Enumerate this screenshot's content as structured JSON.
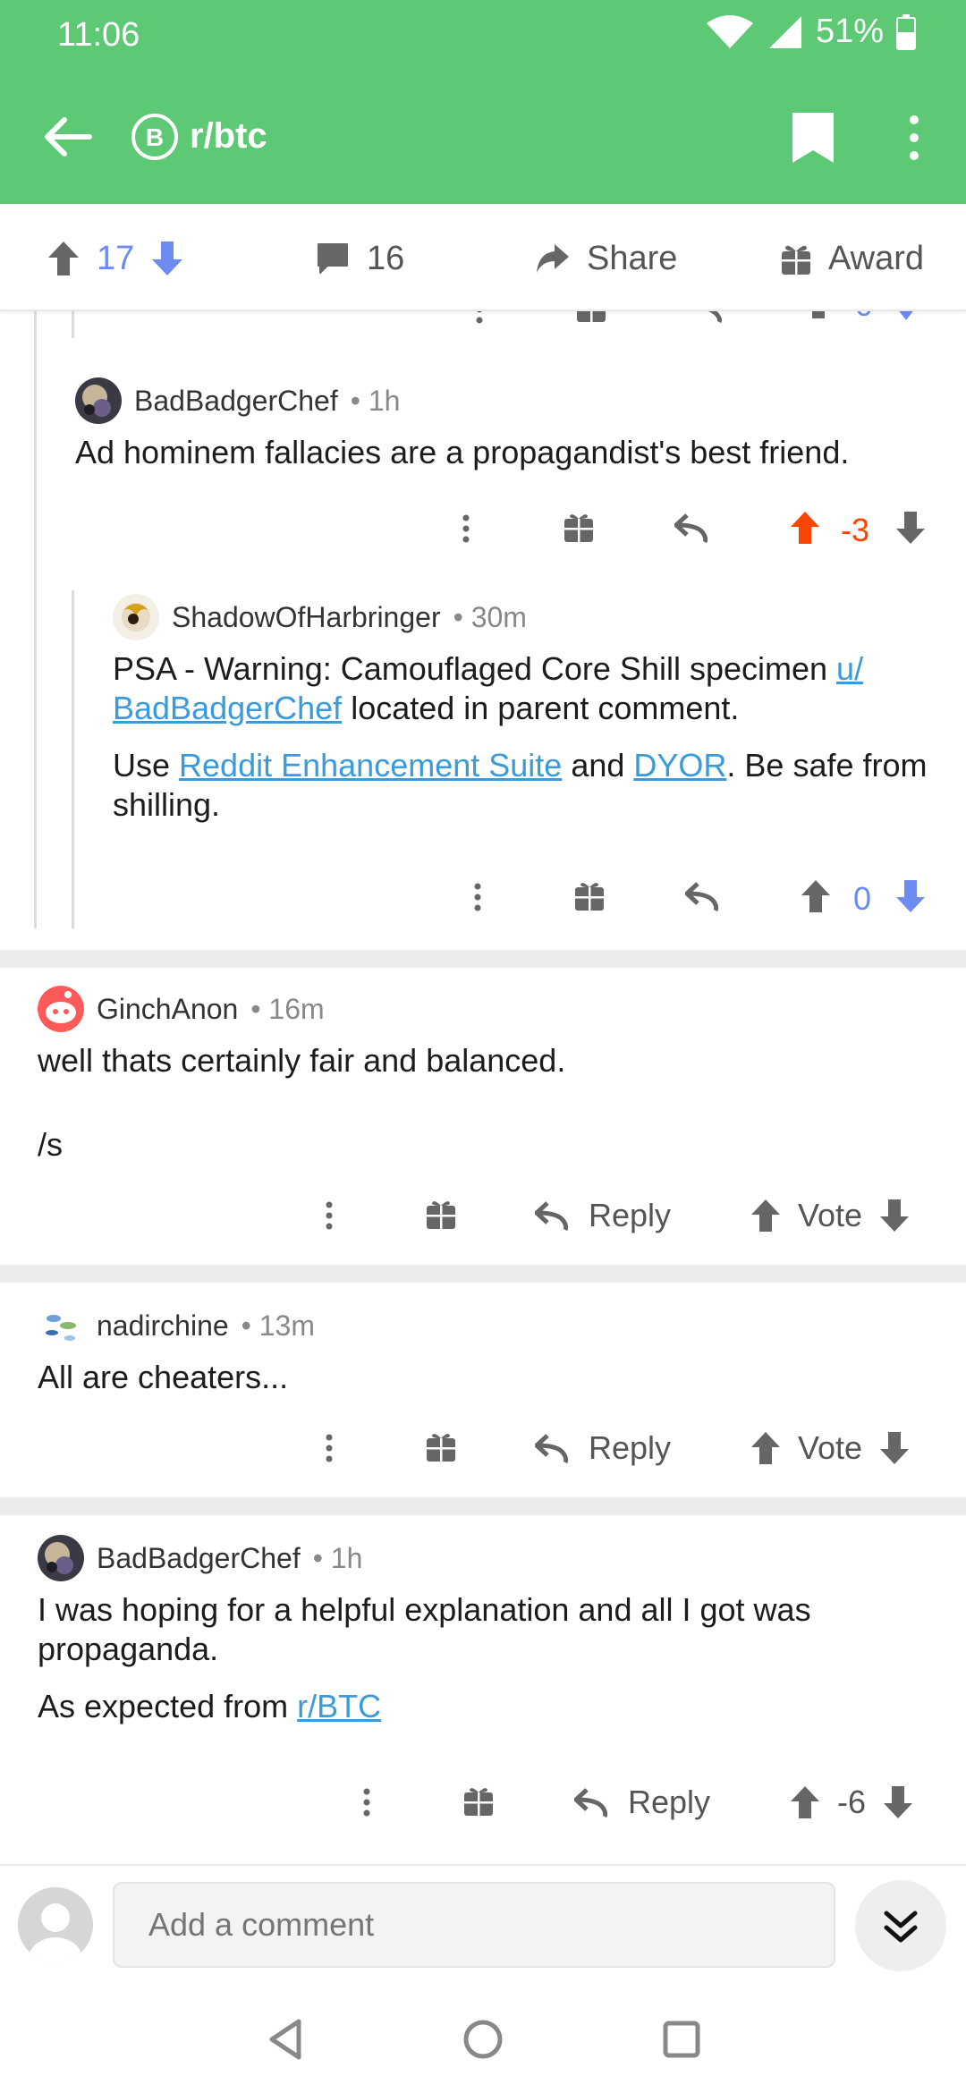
{
  "status": {
    "time": "11:06",
    "battery": "51%"
  },
  "appbar": {
    "subreddit": "r/btc"
  },
  "post_bar": {
    "score": "17",
    "comments": "16",
    "share": "Share",
    "award": "Award"
  },
  "comments": [
    {
      "id": "c1",
      "author": "BadBadgerChef",
      "age": "• 1h",
      "body": "Ad hominem fallacies are a propagandist's best friend.",
      "score": "-3"
    },
    {
      "id": "c2",
      "author": "ShadowOfHarbringer",
      "age": "• 30m",
      "body_line1_a": "PSA - Warning: Camouflaged Core Shill specimen ",
      "body_line1_link": "u/",
      "body_line2_link": "BadBadgerChef",
      "body_line2_b": " located in parent comment.",
      "body_p2_a": "Use ",
      "body_p2_link1": "Reddit Enhancement Suite",
      "body_p2_b": " and ",
      "body_p2_link2": "DYOR",
      "body_p2_c": ". Be safe from",
      "body_p2_line2": "shilling.",
      "score": "0"
    },
    {
      "id": "c3",
      "author": "GinchAnon",
      "age": "• 16m",
      "body_line1": "well thats certainly fair and balanced.",
      "body_line2": "/s",
      "reply": "Reply",
      "vote": "Vote"
    },
    {
      "id": "c4",
      "author": "nadirchine",
      "age": "• 13m",
      "body": "All are cheaters...",
      "reply": "Reply",
      "vote": "Vote"
    },
    {
      "id": "c5",
      "author": "BadBadgerChef",
      "age": "• 1h",
      "body_line1": "I was hoping for a helpful explanation and all I got was",
      "body_line2": "propaganda.",
      "body_p2_a": "As expected from ",
      "body_p2_link": "r/BTC",
      "reply": "Reply",
      "score": "-6"
    }
  ],
  "composer": {
    "placeholder": "Add a comment"
  },
  "colors": {
    "accent": "#5ec975",
    "upvote": "#ff4500",
    "downvote": "#6c8cf0",
    "link": "#3a9bdc"
  },
  "icons": [
    "back-arrow-icon",
    "bitcoin-icon",
    "bookmark-icon",
    "more-vertical-icon",
    "upvote-icon",
    "downvote-icon",
    "comment-icon",
    "share-icon",
    "gift-icon",
    "reply-icon",
    "chevrons-down-icon",
    "nav-back-icon",
    "nav-home-icon",
    "nav-recents-icon"
  ]
}
